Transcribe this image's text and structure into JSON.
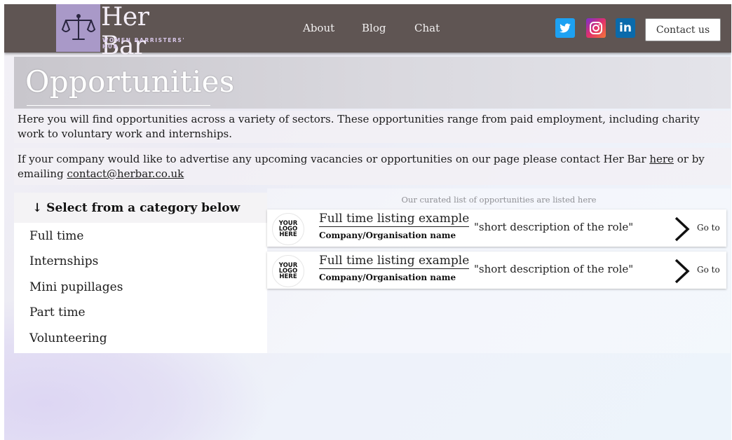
{
  "header": {
    "logo_title": "Her Bar",
    "logo_subtitle": "WOMEN BARRISTERS' HUB",
    "nav": [
      "About",
      "Blog",
      "Chat"
    ],
    "social": [
      "twitter-icon",
      "instagram-icon",
      "linkedin-icon"
    ],
    "linkedin_label": "in",
    "contact_label": "Contact us"
  },
  "page": {
    "title": "Opportunities",
    "intro": "Here you will find opportunities across a variety of sectors. These opportunities range from paid employment, including charity work to voluntary work and internships.",
    "advertise_prefix": "If your company would like to advertise any upcoming vacancies or opportunities on our page please contact Her Bar",
    "advertise_link": "here",
    "advertise_mid": "or by emailing",
    "advertise_email": "contact@herbar.co.uk"
  },
  "sidebar": {
    "heading": "↓ Select from a category below",
    "categories": [
      "Full time",
      "Internships",
      "Mini pupillages",
      "Part time",
      "Volunteering"
    ],
    "active_index": 0
  },
  "listing": {
    "caption": "Our curated list of opportunities are listed here",
    "cards": [
      {
        "logo_lines": [
          "YOUR",
          "LOGO",
          "HERE"
        ],
        "title": "Full time listing example",
        "company": "Company/Organisation name",
        "description": "\"short description of the role\"",
        "goto": "Go to"
      },
      {
        "logo_lines": [
          "YOUR",
          "LOGO",
          "HERE"
        ],
        "title": "Full time listing example",
        "company": "Company/Organisation name",
        "description": "\"short description of the role\"",
        "goto": "Go to"
      }
    ]
  },
  "colors": {
    "header_bg": "#5f5553",
    "logo_purple": "#a999c8",
    "twitter": "#1da1f2",
    "linkedin": "#0a6aab"
  }
}
